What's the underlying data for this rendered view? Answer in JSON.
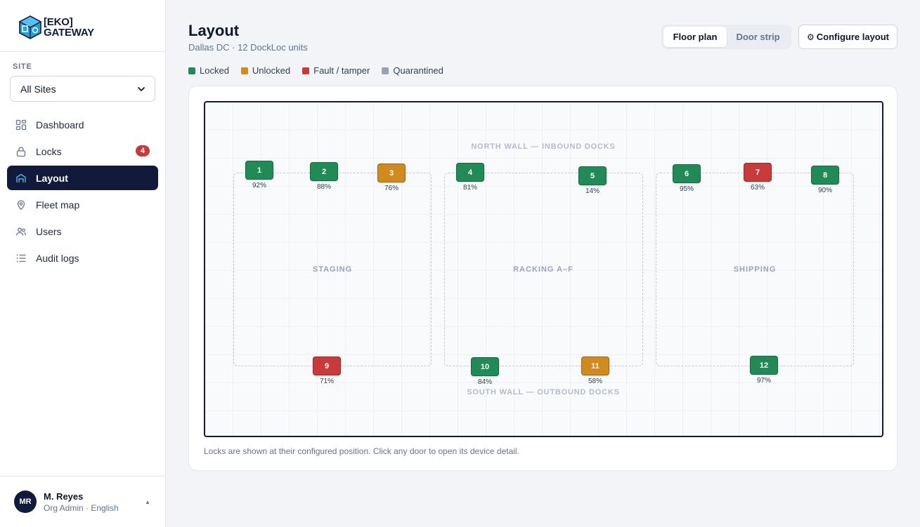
{
  "brand": {
    "line1": "[EKO]",
    "line2": "GATEWAY"
  },
  "sidebar": {
    "site_label": "SITE",
    "site_select": "All Sites",
    "items": [
      {
        "label": "Dashboard",
        "icon": "grid-icon"
      },
      {
        "label": "Locks",
        "icon": "lock-icon",
        "badge": "4"
      },
      {
        "label": "Layout",
        "icon": "warehouse-icon",
        "active": true
      },
      {
        "label": "Fleet map",
        "icon": "map-pin-icon"
      },
      {
        "label": "Users",
        "icon": "users-icon"
      },
      {
        "label": "Audit logs",
        "icon": "list-icon"
      }
    ],
    "user": {
      "initials": "MR",
      "name": "M. Reyes",
      "role": "Org Admin · English"
    }
  },
  "header": {
    "title": "Layout",
    "subtitle": "Dallas DC · 12 DockLoc units",
    "view_toggle": [
      "Floor plan",
      "Door strip"
    ],
    "active_view": "Floor plan",
    "configure_label": "Configure layout"
  },
  "legend": [
    {
      "label": "Locked",
      "color": "#218a56"
    },
    {
      "label": "Unlocked",
      "color": "#d08a1e"
    },
    {
      "label": "Fault / tamper",
      "color": "#c93a3a"
    },
    {
      "label": "Quarantined",
      "color": "#9aa3b2"
    }
  ],
  "floor_plan": {
    "north_wall": "NORTH WALL — INBOUND DOCKS",
    "south_wall": "SOUTH WALL — OUTBOUND DOCKS",
    "zones": [
      "STAGING",
      "RACKING A–F",
      "SHIPPING"
    ],
    "locks": [
      {
        "id": "1",
        "pct": "92%",
        "status": "locked"
      },
      {
        "id": "2",
        "pct": "88%",
        "status": "locked"
      },
      {
        "id": "3",
        "pct": "76%",
        "status": "unlocked"
      },
      {
        "id": "4",
        "pct": "81%",
        "status": "locked"
      },
      {
        "id": "5",
        "pct": "14%",
        "status": "locked"
      },
      {
        "id": "6",
        "pct": "95%",
        "status": "locked"
      },
      {
        "id": "7",
        "pct": "63%",
        "status": "fault"
      },
      {
        "id": "8",
        "pct": "90%",
        "status": "locked"
      },
      {
        "id": "9",
        "pct": "71%",
        "status": "fault"
      },
      {
        "id": "10",
        "pct": "84%",
        "status": "locked"
      },
      {
        "id": "11",
        "pct": "58%",
        "status": "unlocked"
      },
      {
        "id": "12",
        "pct": "97%",
        "status": "locked"
      }
    ],
    "footnote": "Locks are shown at their configured position. Click any door to open its device detail."
  }
}
